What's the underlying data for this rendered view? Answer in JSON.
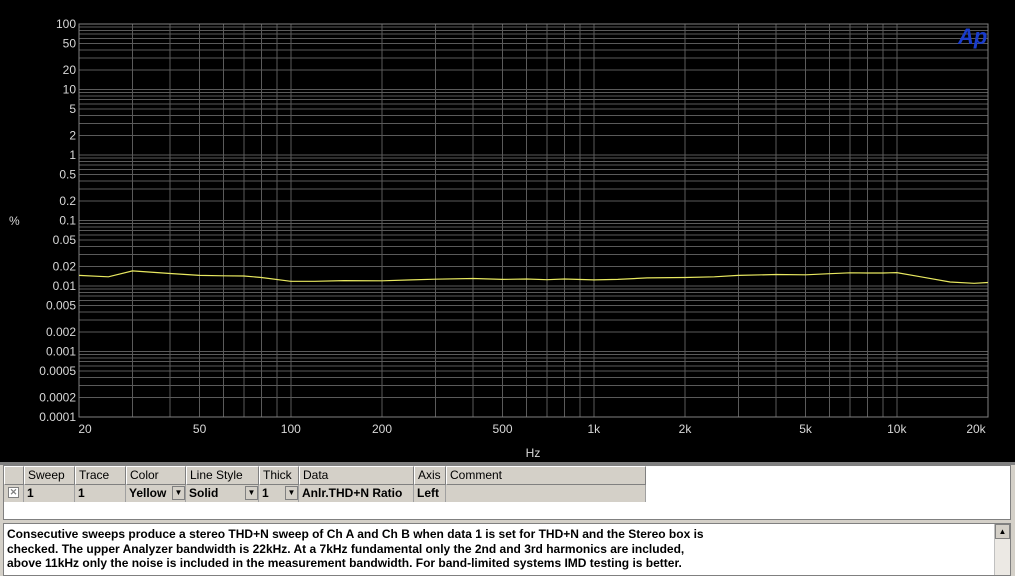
{
  "chart_data": {
    "type": "line",
    "ylabel": "%",
    "xlabel": "Hz",
    "x_scale": "log",
    "y_scale": "log",
    "xlim": [
      20,
      20000
    ],
    "ylim": [
      0.0001,
      100
    ],
    "x_ticks": [
      {
        "v": 20,
        "label": "20"
      },
      {
        "v": 50,
        "label": "50"
      },
      {
        "v": 100,
        "label": "100"
      },
      {
        "v": 200,
        "label": "200"
      },
      {
        "v": 500,
        "label": "500"
      },
      {
        "v": 1000,
        "label": "1k"
      },
      {
        "v": 2000,
        "label": "2k"
      },
      {
        "v": 5000,
        "label": "5k"
      },
      {
        "v": 10000,
        "label": "10k"
      },
      {
        "v": 20000,
        "label": "20k"
      }
    ],
    "y_ticks": [
      {
        "v": 100,
        "label": "100"
      },
      {
        "v": 50,
        "label": "50"
      },
      {
        "v": 20,
        "label": "20"
      },
      {
        "v": 10,
        "label": "10"
      },
      {
        "v": 5,
        "label": "5"
      },
      {
        "v": 2,
        "label": "2"
      },
      {
        "v": 1,
        "label": "1"
      },
      {
        "v": 0.5,
        "label": "0.5"
      },
      {
        "v": 0.2,
        "label": "0.2"
      },
      {
        "v": 0.1,
        "label": "0.1"
      },
      {
        "v": 0.05,
        "label": "0.05"
      },
      {
        "v": 0.02,
        "label": "0.02"
      },
      {
        "v": 0.01,
        "label": "0.01"
      },
      {
        "v": 0.005,
        "label": "0.005"
      },
      {
        "v": 0.002,
        "label": "0.002"
      },
      {
        "v": 0.001,
        "label": "0.001"
      },
      {
        "v": 0.0005,
        "label": "0.0005"
      },
      {
        "v": 0.0002,
        "label": "0.0002"
      },
      {
        "v": 0.0001,
        "label": "0.0001"
      }
    ],
    "grid": true,
    "series": [
      {
        "color": "#e8e860",
        "x": [
          20,
          25,
          30,
          40,
          50,
          60,
          70,
          80,
          100,
          120,
          150,
          200,
          250,
          300,
          400,
          500,
          600,
          700,
          800,
          1000,
          1200,
          1500,
          2000,
          2500,
          3000,
          4000,
          5000,
          6000,
          7000,
          8000,
          9000,
          10000,
          12000,
          15000,
          18000,
          20000
        ],
        "y": [
          0.0145,
          0.0138,
          0.017,
          0.0155,
          0.0145,
          0.0143,
          0.0142,
          0.0135,
          0.0118,
          0.0118,
          0.0121,
          0.012,
          0.0124,
          0.0127,
          0.013,
          0.0126,
          0.0128,
          0.0125,
          0.0128,
          0.0124,
          0.0126,
          0.0133,
          0.0135,
          0.0138,
          0.0145,
          0.015,
          0.0148,
          0.0154,
          0.0159,
          0.0158,
          0.0158,
          0.016,
          0.0138,
          0.0115,
          0.011,
          0.0113
        ]
      }
    ]
  },
  "logo": {
    "text": "Ap",
    "color": "#1a3ccc"
  },
  "colors": {
    "background": "#000000",
    "grid": "#5a5a5a",
    "tick_text": "#d8d8d8"
  },
  "trace_table": {
    "headers": [
      "Sweep",
      "Trace",
      "Color",
      "Line Style",
      "Thick",
      "Data",
      "Axis",
      "Comment"
    ],
    "rows": [
      {
        "sweep": "1",
        "trace": "1",
        "color": "Yellow",
        "line_style": "Solid",
        "thick": "1",
        "data": "Anlr.THD+N Ratio",
        "axis": "Left",
        "comment": ""
      }
    ]
  },
  "notes": {
    "text": "Consecutive sweeps produce a stereo THD+N sweep of Ch A and Ch B when data 1 is set for THD+N and the Stereo box is\nchecked.  The upper Analyzer bandwidth is 22kHz.  At a 7kHz fundamental only the 2nd and 3rd harmonics are included,\nabove 11kHz only the noise is included in the measurement bandwidth.  For band-limited systems IMD testing is better."
  }
}
